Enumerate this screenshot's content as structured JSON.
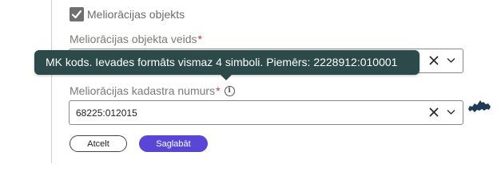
{
  "form": {
    "checkbox": {
      "label": "Meliorācijas objekts",
      "checked": true
    },
    "object_type": {
      "label": "Meliorācijas objekta veids",
      "required_mark": "*",
      "value": ""
    },
    "cadastre": {
      "label": "Meliorācijas kadastra numurs",
      "required_mark": "*",
      "info_glyph": "i",
      "value": "68225:012015"
    },
    "tooltip": {
      "text": "MK kods. Ievades formāts vismaz 4 simboli. Piemērs: 2228912:010001"
    },
    "buttons": {
      "cancel": "Atcelt",
      "save": "Saglabāt"
    }
  },
  "colors": {
    "tooltip_bg": "#2d4a4b",
    "save_button": "#5a46d6",
    "required": "#c0392b",
    "map_icon": "#1f3b57"
  },
  "icons": {
    "clear": "close-icon",
    "dropdown": "chevron-down-icon",
    "info": "info-icon",
    "map": "latvia-map-icon",
    "check": "checkmark-icon"
  }
}
